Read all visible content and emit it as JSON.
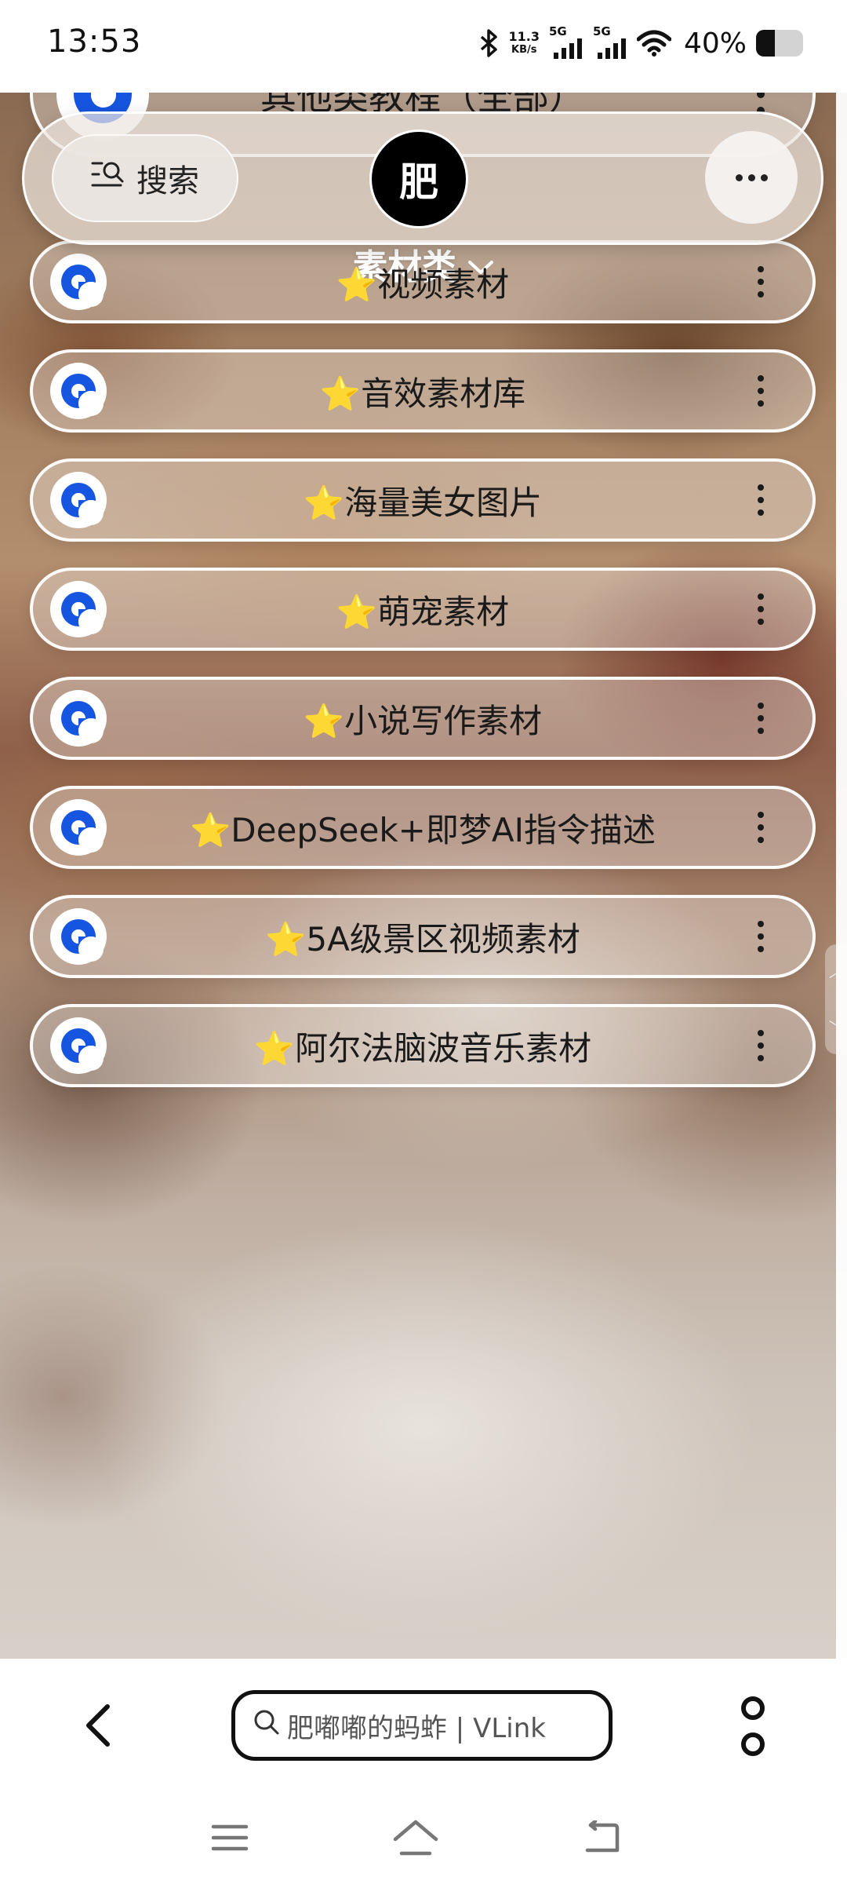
{
  "status_bar": {
    "time": "13:53",
    "net_speed_value": "11.3",
    "net_speed_unit": "KB/s",
    "sim1_label": "5G",
    "sim2_label": "5G",
    "battery_percent_text": "40%",
    "battery_level": 0.4
  },
  "header": {
    "search_label": "搜索",
    "avatar_char": "肥",
    "category_label": "素材类"
  },
  "partial_top_item": {
    "title": "其他类教程（全部）"
  },
  "list_items": [
    {
      "title": "⭐视频素材"
    },
    {
      "title": "⭐音效素材库"
    },
    {
      "title": "⭐海量美女图片"
    },
    {
      "title": "⭐萌宠素材"
    },
    {
      "title": "⭐小说写作素材"
    },
    {
      "title": "⭐DeepSeek+即梦AI指令描述"
    },
    {
      "title": "⭐5A级景区视频素材"
    },
    {
      "title": "⭐阿尔法脑波音乐素材"
    }
  ],
  "browser_bar": {
    "url_text": "肥嘟嘟的蚂蚱 | VLink"
  },
  "colors": {
    "logo_blue": "#1655e0",
    "pill_border": "#ffffff"
  }
}
